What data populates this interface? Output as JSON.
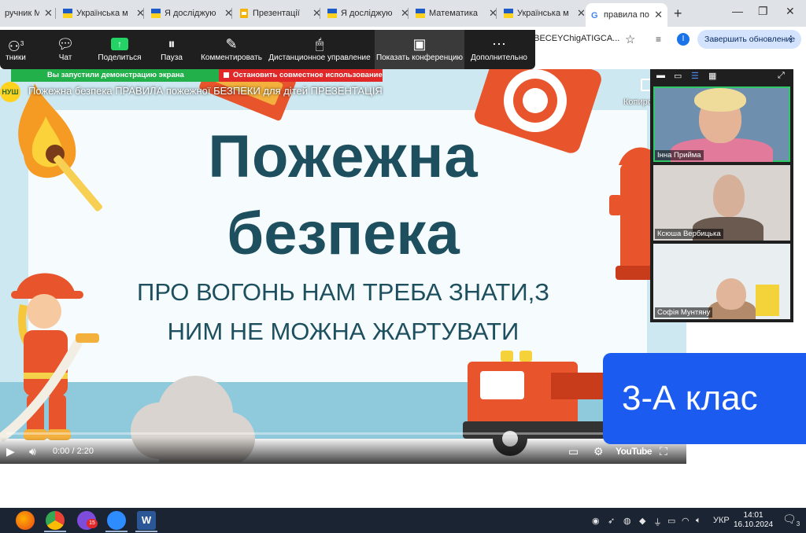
{
  "browser": {
    "tabs": [
      {
        "label": "ручник М",
        "active": false
      },
      {
        "label": "Українська м",
        "active": false
      },
      {
        "label": "Я досліджую",
        "active": false
      },
      {
        "label": "Презентації",
        "active": false
      },
      {
        "label": "Я досліджую",
        "active": false
      },
      {
        "label": "Математика",
        "active": false
      },
      {
        "label": "Українська м",
        "active": false
      },
      {
        "label": "правила пож",
        "active": true
      }
    ],
    "new_tab_icon": "plus-icon",
    "url_fragment": "gBECEYChigATIGCA...",
    "profile_initial": "І",
    "update_button": "Завершить обновление"
  },
  "zoom": {
    "participants_count": "3",
    "toolbar": [
      {
        "label": "тники",
        "icon": "participants-icon"
      },
      {
        "label": "Чат",
        "icon": "chat-icon"
      },
      {
        "label": "Поделиться",
        "icon": "share-screen-icon"
      },
      {
        "label": "Пауза",
        "icon": "pause-icon"
      },
      {
        "label": "Комментировать",
        "icon": "annotate-icon"
      },
      {
        "label": "Дистанционное управление",
        "icon": "remote-control-icon"
      },
      {
        "label": "Показать конференцию",
        "icon": "show-meeting-icon"
      },
      {
        "label": "Дополнительно",
        "icon": "more-icon"
      }
    ],
    "share_banner": "Вы запустили демонстрацию экрана",
    "stop_share": "Остановить совместное использование",
    "participants": [
      {
        "name": "Інна Прийма",
        "speaking": true
      },
      {
        "name": "Ксюша Вербицька",
        "speaking": false
      },
      {
        "name": "Софія Мунтяну",
        "speaking": false
      }
    ]
  },
  "video": {
    "logo_text": "НУШ",
    "title": "Пожежна безпека ПРАВИЛА пожежної БЕЗПЕКИ для дітей ПРЕЗЕНТАЦІЯ",
    "copy_label": "Копиро",
    "slide": {
      "title_line1": "Пожежна",
      "title_line2": "безпека",
      "subtitle_line1": "ПРО ВОГОНЬ НАМ ТРЕБА ЗНАТИ,З",
      "subtitle_line2": "НИМ НЕ МОЖНА ЖАРТУВАТИ"
    },
    "time": "0:00 / 2:20",
    "progress": 0,
    "youtube_label": "YouTube"
  },
  "class_badge": "3-А клас",
  "taskbar": {
    "language": "УКР",
    "time": "14:01",
    "date": "16.10.2024",
    "notifications": "3",
    "viber_badge": "15"
  },
  "colors": {
    "slide_text": "#1d4f5f",
    "zoom_bar": "#1f1f1f",
    "share_green": "#22b04b",
    "stop_red": "#e02828",
    "badge_blue": "#1c5bf0"
  }
}
